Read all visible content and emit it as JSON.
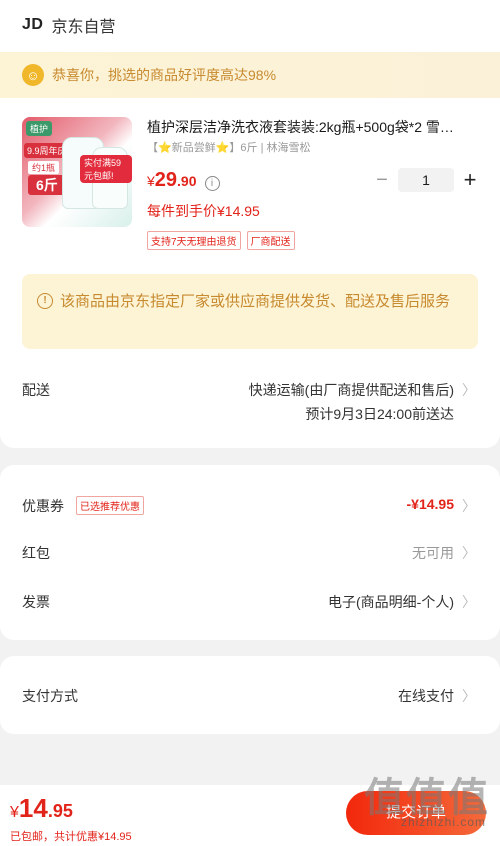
{
  "header": {
    "logo": "JD",
    "store": "京东自营"
  },
  "congrats": {
    "text": "恭喜你，挑选的商品好评度高达98%"
  },
  "product": {
    "title": "植护深层洁净洗衣液套装装:2kg瓶+500g袋*2 雪…",
    "subtitle": "【⭐新品尝鲜⭐】6斤 | 林海雪松",
    "price_yen": "¥",
    "price_int": "29",
    "price_dec": ".90",
    "unit_price": "每件到手价¥14.95",
    "quantity": "1",
    "tags": [
      "支持7天无理由退货",
      "厂商配送"
    ],
    "image_tags": {
      "brand": "植护",
      "sale": "9.9周年庆",
      "qty": "约1瓶",
      "weight": "6斤",
      "promo": "实付满59元包邮!"
    }
  },
  "notice": {
    "text": "该商品由京东指定厂家或供应商提供发货、配送及售后服务"
  },
  "delivery": {
    "label": "配送",
    "method": "快递运输(由厂商提供配送和售后)",
    "eta": "预计9月3日24:00前送达"
  },
  "payment_rows": {
    "coupon_label": "优惠券",
    "coupon_tag": "已选推荐优惠",
    "coupon_value": "-¥14.95",
    "redpacket_label": "红包",
    "redpacket_value": "无可用",
    "invoice_label": "发票",
    "invoice_value": "电子(商品明细-个人)"
  },
  "pay_method": {
    "label": "支付方式",
    "value": "在线支付"
  },
  "footer": {
    "total_yen": "¥",
    "total_int": "14",
    "total_dec": ".95",
    "note": "已包邮，共计优惠¥14.95",
    "submit": "提交订单",
    "watermark": "值值值",
    "watermark_url": "zhizhizhi.com"
  },
  "colors": {
    "accent": "#e2231a",
    "notice": "#c78a2e",
    "notice_bg": "#fdf3d5"
  }
}
